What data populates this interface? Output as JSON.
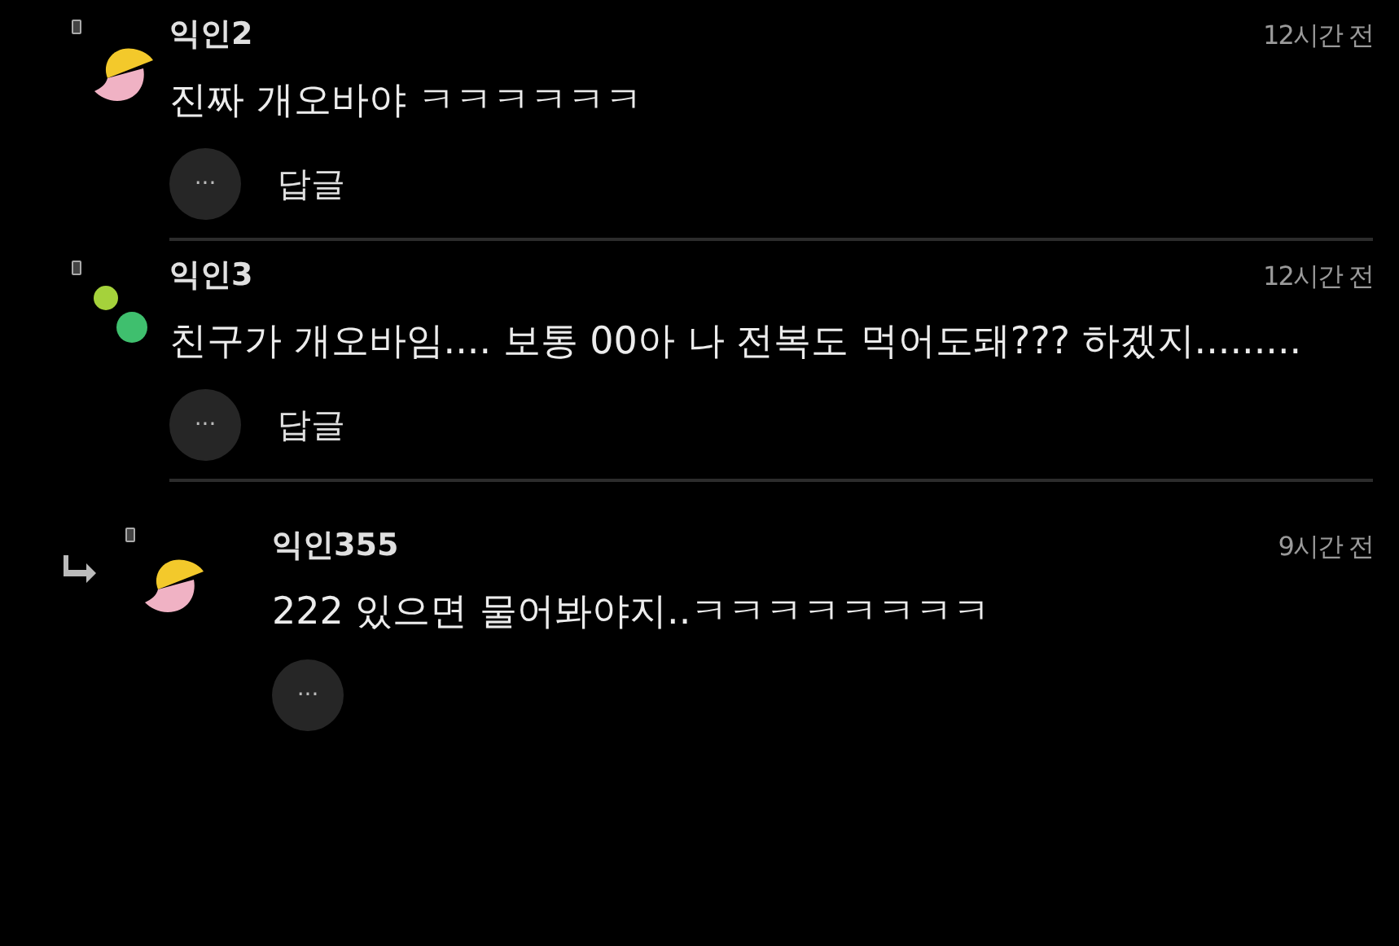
{
  "comments": [
    {
      "author": "익인2",
      "time": "12시간 전",
      "avatar": {
        "kind": "halfmoon"
      },
      "body": "진짜 개오바야 ㅋㅋㅋㅋㅋㅋ",
      "more": "···",
      "reply_label": "답글",
      "is_reply": false
    },
    {
      "author": "익인3",
      "time": "12시간 전",
      "avatar": {
        "kind": "dots"
      },
      "body": "친구가 개오바임.... 보통 00아 나 전복도 먹어도돼??? 하겠지.........",
      "more": "···",
      "reply_label": "답글",
      "is_reply": false
    },
    {
      "author": "익인355",
      "time": "9시간 전",
      "avatar": {
        "kind": "halfmoon"
      },
      "body": "222 있으면 물어봐야지..ㅋㅋㅋㅋㅋㅋㅋㅋ",
      "more": "···",
      "is_reply": true
    }
  ]
}
